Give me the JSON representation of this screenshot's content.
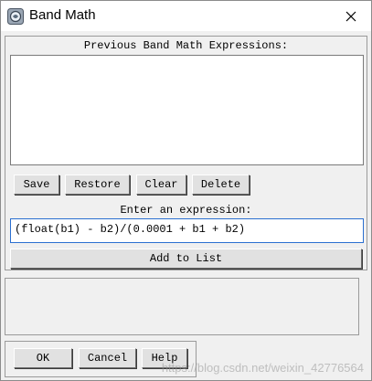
{
  "window": {
    "title": "Band Math",
    "close_glyph": "✕"
  },
  "history": {
    "label": "Previous Band Math Expressions:",
    "items": []
  },
  "history_buttons": {
    "save": "Save",
    "restore": "Restore",
    "clear": "Clear",
    "delete": "Delete"
  },
  "expression": {
    "label": "Enter an expression:",
    "value": "(float(b1) - b2)/(0.0001 + b1 + b2)",
    "add_label": "Add to List"
  },
  "dialog_buttons": {
    "ok": "OK",
    "cancel": "Cancel",
    "help": "Help"
  },
  "watermark": "https://blog.csdn.net/weixin_42776564",
  "icons": {
    "app": "band-math-app-icon",
    "close": "close-icon"
  },
  "colors": {
    "input_focus_border": "#2a6fd0",
    "window_bg": "#f0f0f0"
  }
}
